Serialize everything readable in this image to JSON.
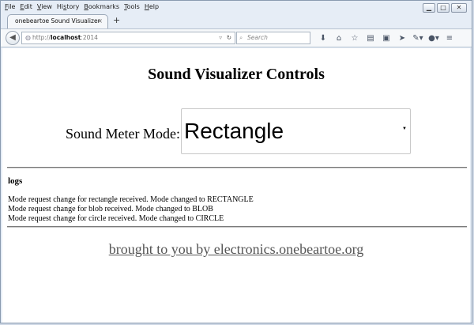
{
  "menu": [
    "File",
    "Edit",
    "View",
    "History",
    "Bookmarks",
    "Tools",
    "Help"
  ],
  "menu_mnemonics": [
    "F",
    "E",
    "V",
    "s",
    "B",
    "T",
    "H"
  ],
  "window_controls": {
    "minimize": "▁",
    "maximize": "□",
    "close": "✕"
  },
  "tab": {
    "title": "onebeartoe Sound Visualizer",
    "close": "×",
    "new_tab": "+"
  },
  "nav": {
    "url_prefix": "http://",
    "url_host": "localhost",
    "url_port": ":2014",
    "search_placeholder": "Search"
  },
  "icons": {
    "back": "back-arrow-icon",
    "globe": "globe-icon",
    "reload": "reload-icon",
    "search": "search-icon",
    "download": "download-icon",
    "home": "home-icon",
    "star": "bookmark-star-icon",
    "library": "library-icon",
    "pocket": "reader-icon",
    "send": "send-icon",
    "tool": "tool-icon",
    "account": "account-icon",
    "menu": "hamburger-menu-icon"
  },
  "page": {
    "title": "Sound Visualizer Controls",
    "mode_label": "Sound Meter Mode:",
    "mode_selected": "Rectangle",
    "logs_title": "logs",
    "log_lines": [
      "Mode request change for rectangle received. Mode changed to RECTANGLE",
      "Mode request change for blob received. Mode changed to BLOB",
      "Mode request change for circle received. Mode changed to CIRCLE"
    ],
    "footer_link": "brought to you by electronics.onebeartoe.org"
  },
  "colors": {
    "footer_link": "#555555",
    "chrome": "#e6edf6"
  }
}
